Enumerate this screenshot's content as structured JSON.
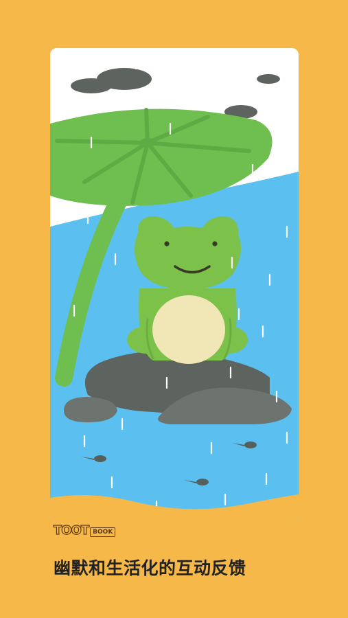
{
  "brand": {
    "name": "TOOT",
    "sub": "BOOK"
  },
  "tagline": "幽默和生活化的互动反馈",
  "colors": {
    "background": "#f7b84a",
    "sky": "#ffffff",
    "water": "#5bc0ef",
    "frog": "#7cc14a",
    "frog_belly": "#f1e6b5",
    "leaf": "#6ebf4f",
    "rock": "#5d645f",
    "rain": "#ffffff"
  },
  "illustration": {
    "subject": "frog-on-rock-in-rain",
    "elements": [
      "lotus-leaf-umbrella",
      "frog",
      "rock",
      "tadpoles",
      "rain",
      "clouds"
    ]
  }
}
